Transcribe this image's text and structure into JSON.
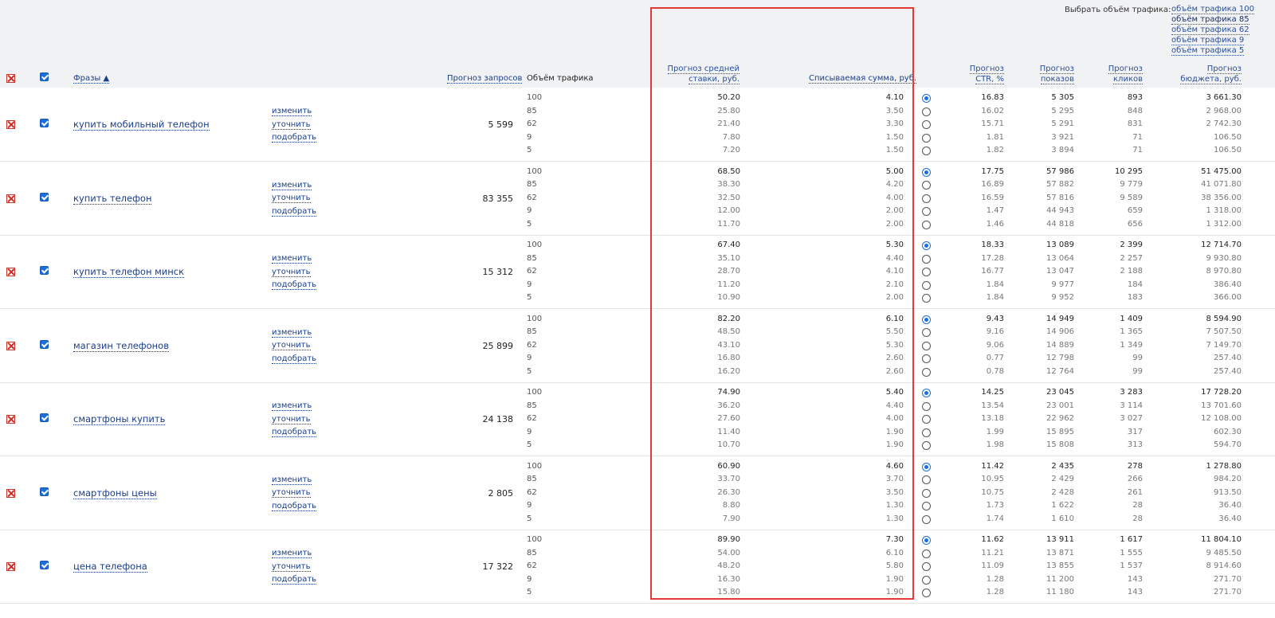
{
  "header": {
    "choose_traffic_label": "Выбрать объём трафика:",
    "traffic_links": [
      "объём трафика 100",
      "объём трафика 85",
      "объём трафика 62",
      "объём трафика 9",
      "объём трафика 5"
    ],
    "col_phrases": "Фразы ▲",
    "col_requests": "Прогноз запросов",
    "col_volume": "Объём трафика",
    "col_bid_line1": "Прогноз средней",
    "col_bid_line2": "ставки, руб.",
    "col_charge": "Списываемая сумма, руб.",
    "col_ctr_line1": "Прогноз",
    "col_ctr_line2": "CTR, %",
    "col_impr_line1": "Прогноз",
    "col_impr_line2": "показов",
    "col_clicks_line1": "Прогноз",
    "col_clicks_line2": "кликов",
    "col_budget_line1": "Прогноз",
    "col_budget_line2": "бюджета, руб."
  },
  "actions": [
    "изменить",
    "уточнить",
    "подобрать"
  ],
  "volumes": [
    "100",
    "85",
    "62",
    "9",
    "5"
  ],
  "rows": [
    {
      "phrase": "купить мобильный телефон",
      "requests": "5 599",
      "bid": [
        "50.20",
        "25.80",
        "21.40",
        "7.80",
        "7.20"
      ],
      "charge": [
        "4.10",
        "3.50",
        "3.30",
        "1.50",
        "1.50"
      ],
      "ctr": [
        "16.83",
        "16.02",
        "15.71",
        "1.81",
        "1.82"
      ],
      "impr": [
        "5 305",
        "5 295",
        "5 291",
        "3 921",
        "3 894"
      ],
      "clicks": [
        "893",
        "848",
        "831",
        "71",
        "71"
      ],
      "budget": [
        "3 661.30",
        "2 968.00",
        "2 742.30",
        "106.50",
        "106.50"
      ]
    },
    {
      "phrase": "купить телефон",
      "requests": "83 355",
      "bid": [
        "68.50",
        "38.30",
        "32.50",
        "12.00",
        "11.70"
      ],
      "charge": [
        "5.00",
        "4.20",
        "4.00",
        "2.00",
        "2.00"
      ],
      "ctr": [
        "17.75",
        "16.89",
        "16.59",
        "1.47",
        "1.46"
      ],
      "impr": [
        "57 986",
        "57 882",
        "57 816",
        "44 943",
        "44 818"
      ],
      "clicks": [
        "10 295",
        "9 779",
        "9 589",
        "659",
        "656"
      ],
      "budget": [
        "51 475.00",
        "41 071.80",
        "38 356.00",
        "1 318.00",
        "1 312.00"
      ]
    },
    {
      "phrase": "купить телефон минск",
      "requests": "15 312",
      "bid": [
        "67.40",
        "35.10",
        "28.70",
        "11.20",
        "10.90"
      ],
      "charge": [
        "5.30",
        "4.40",
        "4.10",
        "2.10",
        "2.00"
      ],
      "ctr": [
        "18.33",
        "17.28",
        "16.77",
        "1.84",
        "1.84"
      ],
      "impr": [
        "13 089",
        "13 064",
        "13 047",
        "9 977",
        "9 952"
      ],
      "clicks": [
        "2 399",
        "2 257",
        "2 188",
        "184",
        "183"
      ],
      "budget": [
        "12 714.70",
        "9 930.80",
        "8 970.80",
        "386.40",
        "366.00"
      ]
    },
    {
      "phrase": "магазин телефонов",
      "requests": "25 899",
      "bid": [
        "82.20",
        "48.50",
        "43.10",
        "16.80",
        "16.20"
      ],
      "charge": [
        "6.10",
        "5.50",
        "5.30",
        "2.60",
        "2.60"
      ],
      "ctr": [
        "9.43",
        "9.16",
        "9.06",
        "0.77",
        "0.78"
      ],
      "impr": [
        "14 949",
        "14 906",
        "14 889",
        "12 798",
        "12 764"
      ],
      "clicks": [
        "1 409",
        "1 365",
        "1 349",
        "99",
        "99"
      ],
      "budget": [
        "8 594.90",
        "7 507.50",
        "7 149.70",
        "257.40",
        "257.40"
      ]
    },
    {
      "phrase": "смартфоны купить",
      "requests": "24 138",
      "bid": [
        "74.90",
        "36.20",
        "27.60",
        "11.40",
        "10.70"
      ],
      "charge": [
        "5.40",
        "4.40",
        "4.00",
        "1.90",
        "1.90"
      ],
      "ctr": [
        "14.25",
        "13.54",
        "13.18",
        "1.99",
        "1.98"
      ],
      "impr": [
        "23 045",
        "23 001",
        "22 962",
        "15 895",
        "15 808"
      ],
      "clicks": [
        "3 283",
        "3 114",
        "3 027",
        "317",
        "313"
      ],
      "budget": [
        "17 728.20",
        "13 701.60",
        "12 108.00",
        "602.30",
        "594.70"
      ]
    },
    {
      "phrase": "смартфоны цены",
      "requests": "2 805",
      "bid": [
        "60.90",
        "33.70",
        "26.30",
        "8.80",
        "7.90"
      ],
      "charge": [
        "4.60",
        "3.70",
        "3.50",
        "1.30",
        "1.30"
      ],
      "ctr": [
        "11.42",
        "10.95",
        "10.75",
        "1.73",
        "1.74"
      ],
      "impr": [
        "2 435",
        "2 429",
        "2 428",
        "1 622",
        "1 610"
      ],
      "clicks": [
        "278",
        "266",
        "261",
        "28",
        "28"
      ],
      "budget": [
        "1 278.80",
        "984.20",
        "913.50",
        "36.40",
        "36.40"
      ]
    },
    {
      "phrase": "цена телефона",
      "requests": "17 322",
      "bid": [
        "89.90",
        "54.00",
        "48.20",
        "16.30",
        "15.80"
      ],
      "charge": [
        "7.30",
        "6.10",
        "5.80",
        "1.90",
        "1.90"
      ],
      "ctr": [
        "11.62",
        "11.21",
        "11.09",
        "1.28",
        "1.28"
      ],
      "impr": [
        "13 911",
        "13 871",
        "13 855",
        "11 200",
        "11 180"
      ],
      "clicks": [
        "1 617",
        "1 555",
        "1 537",
        "143",
        "143"
      ],
      "budget": [
        "11 804.10",
        "9 485.50",
        "8 914.60",
        "271.70",
        "271.70"
      ]
    }
  ]
}
